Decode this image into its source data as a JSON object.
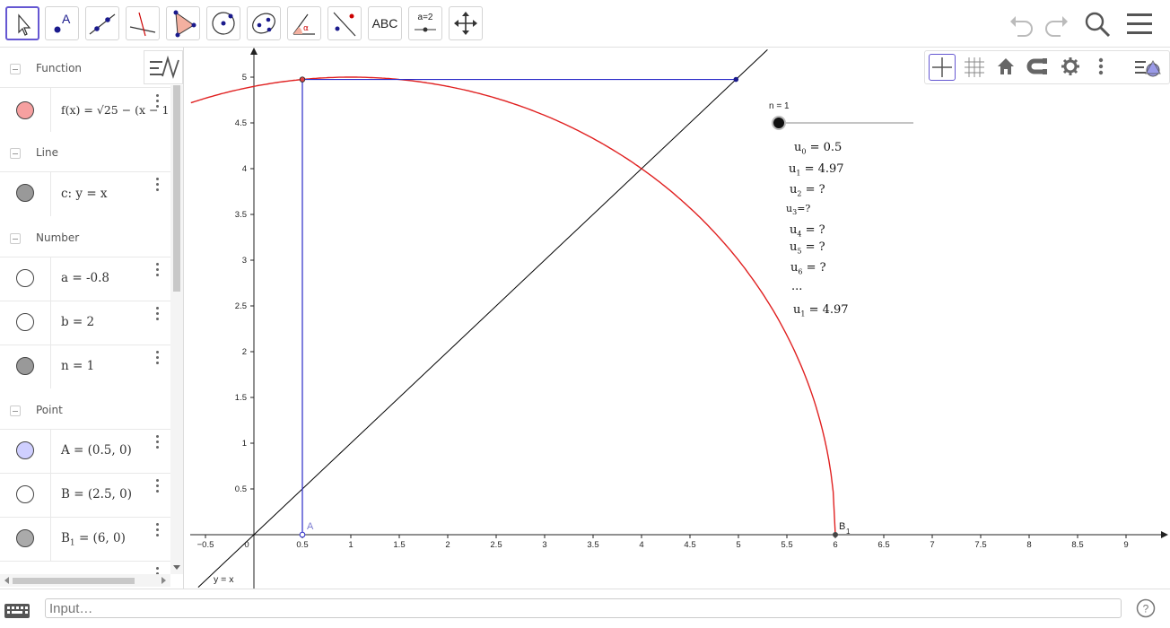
{
  "toolbar": {
    "text_tool_label": "ABC",
    "slider_tool_label": "a=2",
    "active_tool": "move"
  },
  "algebra": {
    "groups": {
      "function": "Function",
      "line": "Line",
      "number": "Number",
      "point": "Point"
    },
    "items": {
      "f": "f(x) = √25 − (x − 1",
      "c": "c: y = x",
      "a": "a = -0.8",
      "b": "b = 2",
      "n": "n = 1",
      "A": "A = (0.5, 0)",
      "B": "B = (2.5, 0)",
      "B1_prefix": "B",
      "B1_sub": "1",
      "B1_rest": " = (6, 0)"
    },
    "colors": {
      "f": "#f6a0a0",
      "c": "#999999",
      "a": "#ffffff",
      "b": "#ffffff",
      "n": "#999999",
      "A": "#cfcfff",
      "B": "#ffffff",
      "B1": "#aaaaaa"
    }
  },
  "graphics": {
    "x_ticks": [
      "−0.5",
      "0",
      "0.5",
      "1",
      "1.5",
      "2",
      "2.5",
      "3",
      "3.5",
      "4",
      "4.5",
      "5",
      "5.5",
      "6",
      "6.5",
      "7",
      "7.5",
      "8",
      "8.5",
      "9"
    ],
    "y_ticks": [
      "0.5",
      "1",
      "1.5",
      "2",
      "2.5",
      "3",
      "3.5",
      "4",
      "4.5",
      "5"
    ],
    "slider_label": "n = 1",
    "point_A_label": "A",
    "point_B1_label": "B",
    "point_B1_sub": "1",
    "line_label": "y = x",
    "colors": {
      "curve": "#e02020",
      "line": "#000000",
      "blue": "#2a2ac8"
    },
    "sequence": [
      {
        "base": "u",
        "sub": "0",
        "rest": " = 0.5"
      },
      {
        "base": "u",
        "sub": "1",
        "rest": " = 4.97"
      },
      {
        "base": "u",
        "sub": "2",
        "rest": " = ?"
      },
      {
        "base": "u",
        "sub": "3",
        "rest": "=?"
      },
      {
        "base": "u",
        "sub": "4",
        "rest": " = ?"
      },
      {
        "base": "u",
        "sub": "5",
        "rest": " = ?"
      },
      {
        "base": "u",
        "sub": "6",
        "rest": " = ?"
      },
      {
        "base": "",
        "sub": "",
        "rest": "..."
      },
      {
        "base": "u",
        "sub": "1",
        "rest": " = 4.97"
      }
    ]
  },
  "input": {
    "placeholder": "Input…"
  }
}
